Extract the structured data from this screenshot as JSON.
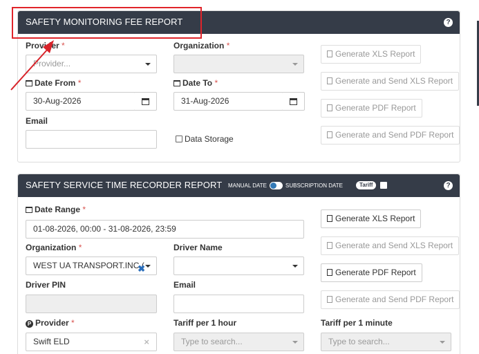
{
  "panel1": {
    "title": "SAFETY MONITORING FEE REPORT",
    "help": "?",
    "provider_label": "Provider",
    "provider_placeholder": "Provider...",
    "organization_label": "Organization",
    "date_from_label": "Date From",
    "date_from_value": "30-Aug-2026",
    "date_to_label": "Date To",
    "date_to_value": "31-Aug-2026",
    "email_label": "Email",
    "data_storage_label": "Data Storage",
    "btn_generate_xls": "Generate XLS Report",
    "btn_generate_send_xls": "Generate and Send XLS Report",
    "btn_generate_pdf": "Generate PDF Report",
    "btn_generate_send_pdf": "Generate and Send PDF Report"
  },
  "panel2": {
    "title": "SAFETY SERVICE TIME RECORDER REPORT",
    "help": "?",
    "manual_date": "MANUAL DATE",
    "subscription_date": "SUBSCRIPTION DATE",
    "tariff_badge": "Tariff",
    "date_range_label": "Date Range",
    "date_range_value": "01-08-2026, 00:00 - 31-08-2026, 23:59",
    "organization_label": "Organization",
    "organization_value": "WEST UA TRANSPORT.INC (",
    "driver_name_label": "Driver Name",
    "driver_pin_label": "Driver PIN",
    "email_label": "Email",
    "provider_label": "Provider",
    "provider_value": "Swift ELD",
    "tariff_hour_label": "Tariff per 1 hour",
    "tariff_hour_placeholder": "Type to search...",
    "tariff_minute_label": "Tariff per 1 minute",
    "tariff_minute_placeholder": "Type to search...",
    "btn_generate_xls": "Generate XLS Report",
    "btn_generate_send_xls": "Generate and Send XLS Report",
    "btn_generate_pdf": "Generate PDF Report",
    "btn_generate_send_pdf": "Generate and Send PDF Report"
  },
  "required_mark": "*",
  "colors": {
    "header": "#353c48",
    "annotation": "#e0242a",
    "required": "#d9534f"
  }
}
